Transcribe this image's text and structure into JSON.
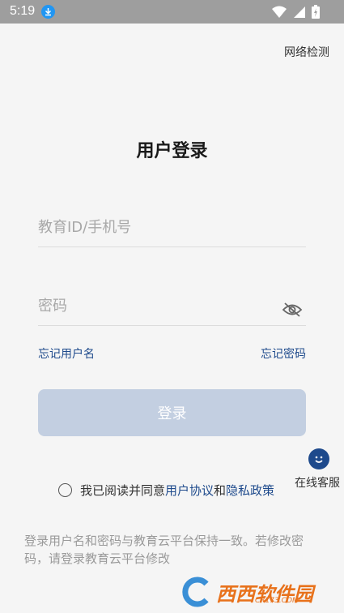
{
  "status_bar": {
    "time": "5:19"
  },
  "header": {
    "net_check": "网络检测"
  },
  "page": {
    "title": "用户登录"
  },
  "form": {
    "username_placeholder": "教育ID/手机号",
    "password_placeholder": "密码",
    "forgot_username": "忘记用户名",
    "forgot_password": "忘记密码",
    "login_label": "登录"
  },
  "service": {
    "label": "在线客服"
  },
  "agreement": {
    "prefix": "我已阅读并同意",
    "user_agreement": "用户协议",
    "and": "和",
    "privacy_policy": "隐私政策"
  },
  "footnote": "登录用户名和密码与教育云平台保持一致。若修改密码，请登录教育云平台修改",
  "watermark": {
    "text": "西西软件园",
    "sub": "CR173.COM"
  },
  "colors": {
    "accent": "#1e4a8c",
    "button_disabled": "#c3cfe1",
    "status_bar": "#9e9e9e"
  }
}
